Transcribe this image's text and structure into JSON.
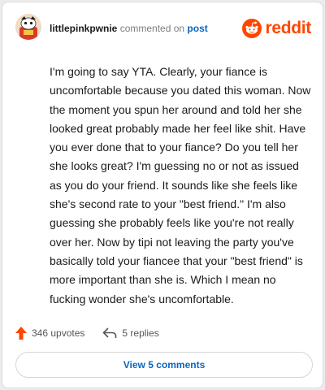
{
  "header": {
    "username": "littlepinkpwnie",
    "action_text": "commented on",
    "post_link": "post",
    "logo_text": "reddit",
    "avatar_icon": "snoo-avatar-icon",
    "logo_icon": "reddit-logo-icon"
  },
  "comment": {
    "body": "I'm going to say YTA. Clearly, your fiance is uncomfortable because you dated this woman. Now the moment you spun her around and told her she looked great probably made her feel like shit. Have you ever done that to your fiance? Do you tell her she looks great? I'm guessing no or not as issued as you do your friend. It sounds like she feels like she's second rate to your \"best friend.\" I'm also guessing she probably feels like you're not really over her. Now by tipi not leaving the party you've basically told your fiancee that your \"best friend\" is more important than she is. Which I mean no fucking wonder she's uncomfortable."
  },
  "actions": {
    "upvotes": "346 upvotes",
    "replies": "5 replies",
    "upvote_icon": "upvote-arrow-icon",
    "reply_icon": "reply-arrow-icon"
  },
  "footer": {
    "view_comments": "View 5 comments"
  },
  "colors": {
    "brand": "#ff4500",
    "link": "#0a66c2"
  }
}
